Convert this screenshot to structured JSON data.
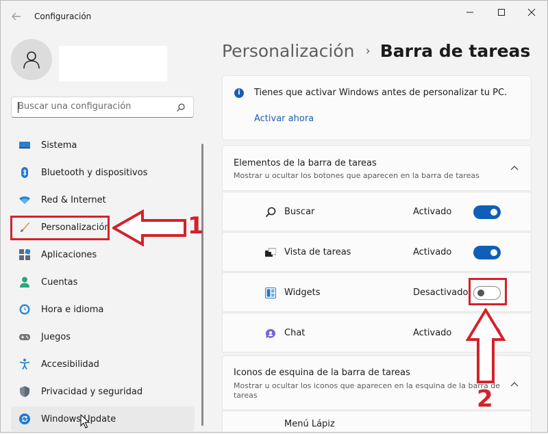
{
  "window": {
    "title": "Configuración"
  },
  "search": {
    "placeholder": "Buscar una configuración"
  },
  "sidebar": {
    "items": [
      {
        "label": "Sistema",
        "icon": "system-icon"
      },
      {
        "label": "Bluetooth y dispositivos",
        "icon": "bluetooth-icon"
      },
      {
        "label": "Red & Internet",
        "icon": "wifi-icon"
      },
      {
        "label": "Personalización",
        "icon": "brush-icon"
      },
      {
        "label": "Aplicaciones",
        "icon": "apps-icon"
      },
      {
        "label": "Cuentas",
        "icon": "accounts-icon"
      },
      {
        "label": "Hora e idioma",
        "icon": "time-language-icon"
      },
      {
        "label": "Juegos",
        "icon": "gamepad-icon"
      },
      {
        "label": "Accesibilidad",
        "icon": "accessibility-icon"
      },
      {
        "label": "Privacidad y seguridad",
        "icon": "shield-icon"
      },
      {
        "label": "Windows Update",
        "icon": "windows-update-icon"
      }
    ]
  },
  "breadcrumb": {
    "parent": "Personalización",
    "separator": "›",
    "current": "Barra de tareas"
  },
  "activation": {
    "message": "Tienes que activar Windows antes de personalizar tu PC.",
    "link": "Activar ahora"
  },
  "taskbar_items": {
    "title": "Elementos de la barra de tareas",
    "description": "Mostrar u ocultar los botones que aparecen en la barra de tareas",
    "rows": [
      {
        "label": "Buscar",
        "state": "Activado",
        "on": true,
        "icon": "search-icon"
      },
      {
        "label": "Vista de tareas",
        "state": "Activado",
        "on": true,
        "icon": "task-view-icon"
      },
      {
        "label": "Widgets",
        "state": "Desactivado",
        "on": false,
        "icon": "widgets-icon"
      },
      {
        "label": "Chat",
        "state": "Activado",
        "on": true,
        "icon": "chat-icon"
      }
    ]
  },
  "corner_icons": {
    "title": "Iconos de esquina de la barra de tareas",
    "description": "Mostrar u ocultar los iconos que aparecen en la esquina de la barra de tareas",
    "rows": [
      {
        "label": "Menú Lápiz"
      }
    ]
  },
  "annotations": {
    "step1": "1",
    "step2": "2",
    "color": "#d3222a"
  },
  "colors": {
    "accent": "#0f5fb8",
    "link": "#1a5fb4"
  }
}
